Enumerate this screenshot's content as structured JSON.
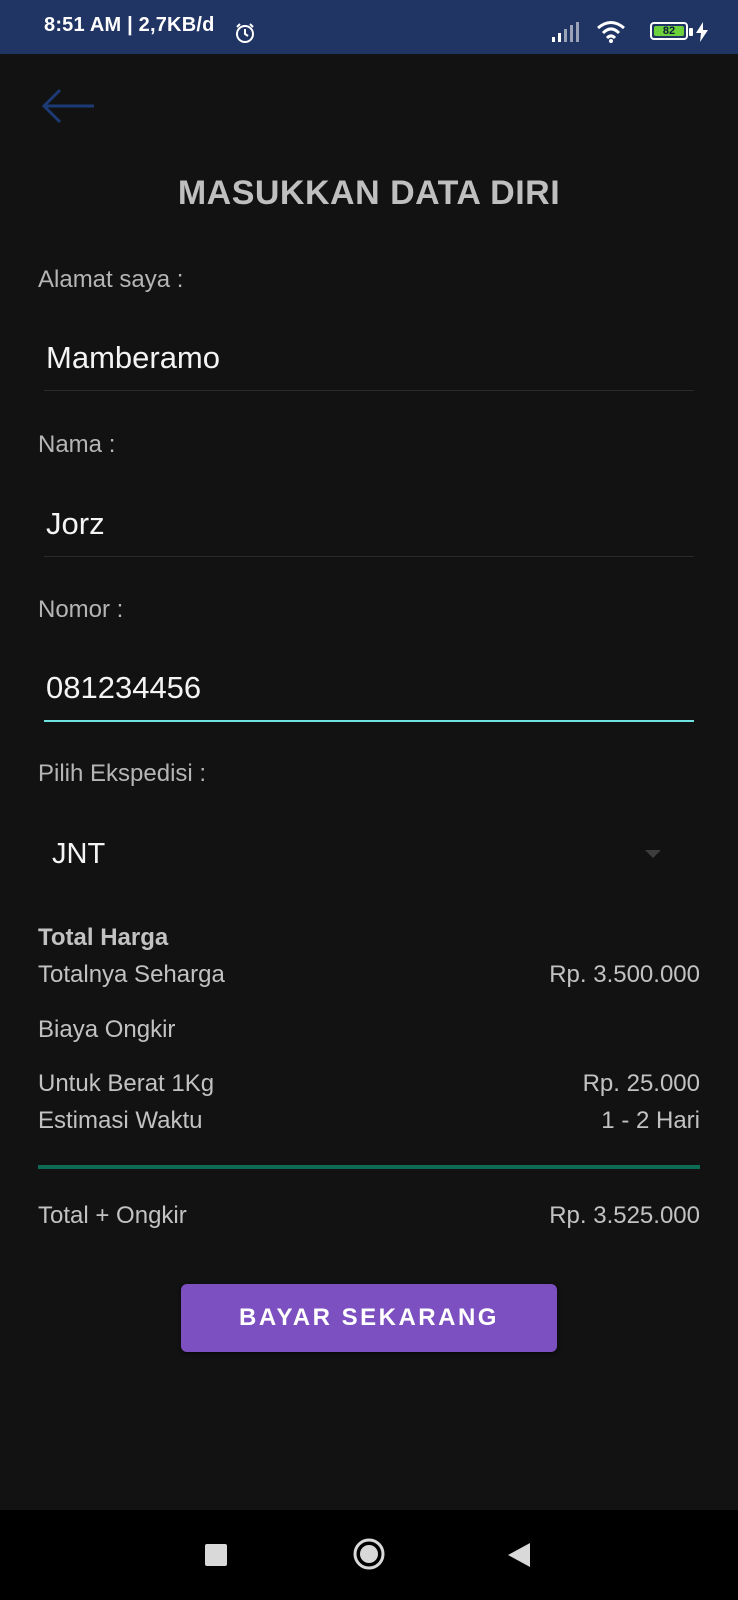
{
  "status_bar": {
    "time": "8:51 AM | 2,7KB/d",
    "battery_level": "82",
    "icons": [
      "alarm-icon",
      "signal-icon",
      "wifi-icon",
      "battery-icon",
      "charging-bolt-icon"
    ]
  },
  "header": {
    "back_icon": "arrow-left-icon",
    "title": "MASUKKAN DATA DIRI"
  },
  "form": {
    "address": {
      "label": "Alamat saya   :",
      "value": "Mamberamo"
    },
    "name": {
      "label": "Nama   :",
      "value": "Jorz"
    },
    "phone": {
      "label": "Nomor  :",
      "value": "081234456"
    },
    "expedition": {
      "label": "Pilih Ekspedisi  :",
      "selected": "JNT"
    }
  },
  "summary": {
    "total_heading": "Total Harga",
    "subtotal_label": "Totalnya Seharga",
    "subtotal_value": "Rp. 3.500.000",
    "shipping_heading": "Biaya Ongkir",
    "weight_label": "Untuk Berat 1Kg",
    "weight_value": "Rp. 25.000",
    "eta_label": "Estimasi Waktu",
    "eta_value": "1 - 2 Hari",
    "grand_total_label": "Total + Ongkir",
    "grand_total_value": "Rp. 3.525.000"
  },
  "actions": {
    "pay_label": "BAYAR SEKARANG"
  },
  "colors": {
    "status_bar": "#213565",
    "background": "#121212",
    "accent_underline": "#6ee3e0",
    "divider": "#0d6a55",
    "button": "#7c50c0"
  }
}
